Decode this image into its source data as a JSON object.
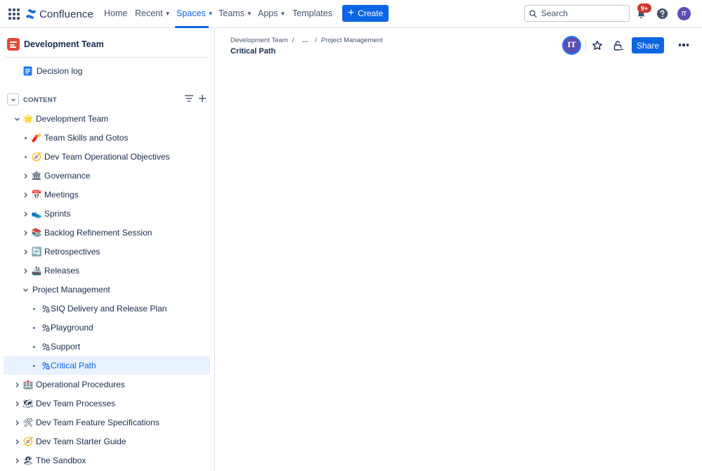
{
  "app": {
    "name": "Confluence"
  },
  "nav": {
    "home": "Home",
    "recent": "Recent",
    "spaces": "Spaces",
    "teams": "Teams",
    "apps": "Apps",
    "templates": "Templates",
    "create": "Create",
    "search_placeholder": "Search",
    "notifications_badge": "9+",
    "user_initials": "IT"
  },
  "sidebar": {
    "space_name": "Development Team",
    "decision_log": "Decision log",
    "content_label": "CONTENT",
    "tree": [
      {
        "label": "Development Team",
        "emoji": "🌟",
        "control": "chevron-down",
        "depth": 0
      },
      {
        "label": "Team Skills and Gotos",
        "emoji": "🧨",
        "control": "bullet",
        "depth": 1
      },
      {
        "label": "Dev Team Operational Objectives",
        "emoji": "🧭",
        "control": "bullet",
        "depth": 1
      },
      {
        "label": "Governance",
        "emoji": "🏛",
        "control": "chevron-right",
        "depth": 1
      },
      {
        "label": "Meetings",
        "emoji": "📅",
        "control": "chevron-right",
        "depth": 1
      },
      {
        "label": "Sprints",
        "emoji": "👟",
        "control": "chevron-right",
        "depth": 1
      },
      {
        "label": "Backlog Refinement Session",
        "emoji": "📚",
        "control": "chevron-right",
        "depth": 1
      },
      {
        "label": "Retrospectives",
        "emoji": "🔄",
        "control": "chevron-right",
        "depth": 1
      },
      {
        "label": "Releases",
        "emoji": "🚢",
        "control": "chevron-right",
        "depth": 1
      },
      {
        "label": "Project Management",
        "emoji": "",
        "control": "chevron-down",
        "depth": 1
      },
      {
        "label": "SIQ Delivery and Release Plan",
        "emoji": "whiteboard",
        "control": "bullet",
        "depth": 2
      },
      {
        "label": "Playground",
        "emoji": "whiteboard",
        "control": "bullet",
        "depth": 2
      },
      {
        "label": "Support",
        "emoji": "whiteboard",
        "control": "bullet",
        "depth": 2
      },
      {
        "label": "Critical Path",
        "emoji": "whiteboard",
        "control": "bullet",
        "depth": 2,
        "selected": true
      },
      {
        "label": "Operational Procedures",
        "emoji": "🏥",
        "control": "chevron-right",
        "depth": 0
      },
      {
        "label": "Dev Team Processes",
        "emoji": "🗺",
        "control": "chevron-right",
        "depth": 0
      },
      {
        "label": "Dev Team Feature Specifications",
        "emoji": "🛠",
        "control": "chevron-right",
        "depth": 0
      },
      {
        "label": "Dev Team Starter Guide",
        "emoji": "🧭",
        "control": "chevron-right",
        "depth": 0
      },
      {
        "label": "The Sandbox",
        "emoji": "🏖",
        "control": "chevron-right",
        "depth": 0
      }
    ]
  },
  "page": {
    "breadcrumb": [
      "Development Team",
      "...",
      "Project Management"
    ],
    "title": "Critical Path",
    "share": "Share",
    "viewer_initials": "IT"
  },
  "colors": {
    "brand": "#0c66e4",
    "selected_bg": "#e9f2ff",
    "badge": "#c9372c",
    "avatar": "#5e4db2",
    "space_icon": "#e34935"
  }
}
